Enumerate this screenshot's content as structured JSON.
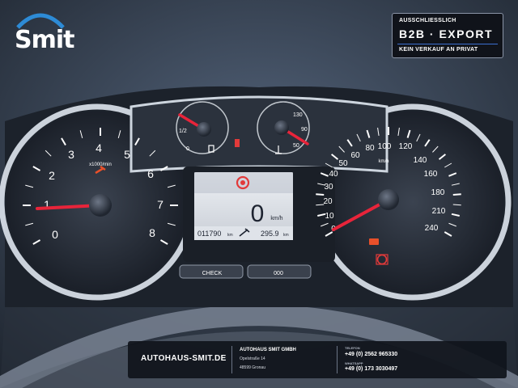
{
  "logo": {
    "text": "Smit"
  },
  "b2b_badge": {
    "top": "AUSSCHLIESSLICH",
    "main": "B2B  ·  EXPORT",
    "bottom": "KEIN VERKAUF AN PRIVAT"
  },
  "tachometer": {
    "unit": "x1000/min",
    "ticks": [
      "0",
      "1",
      "2",
      "3",
      "4",
      "5",
      "6",
      "7",
      "8"
    ],
    "reading": 0
  },
  "fuel_gauge": {
    "ticks": [
      "0",
      "1/2"
    ]
  },
  "temp_gauge": {
    "ticks": [
      "50",
      "90",
      "130"
    ]
  },
  "speedometer": {
    "unit": "km/h",
    "ticks": [
      "0",
      "10",
      "20",
      "30",
      "40",
      "50",
      "60",
      "80",
      "100",
      "120",
      "140",
      "160",
      "180",
      "210",
      "240"
    ],
    "reading": 0
  },
  "display": {
    "speed": "0",
    "speed_unit": "km/h",
    "odometer": "011790",
    "odometer_unit": "km",
    "range": "295.9",
    "range_unit": "km"
  },
  "buttons": {
    "check": "CHECK",
    "trip": "000"
  },
  "dealer": {
    "website": "AUTOHAUS-SMIT.DE",
    "name": "AUTOHAUS SMIT GMBH",
    "street": "Opelstraße 14",
    "city": "48599 Gronau",
    "tel_label": "TELEFON",
    "tel": "+49 (0) 2562 965330",
    "wa_label": "WHATSAPP",
    "wa": "+49 (0) 173 3030497"
  },
  "colors": {
    "needle": "#e8243a",
    "warning": "#e23a3a",
    "accent": "#3b6fd1",
    "chrome": "#dfe6ee"
  }
}
